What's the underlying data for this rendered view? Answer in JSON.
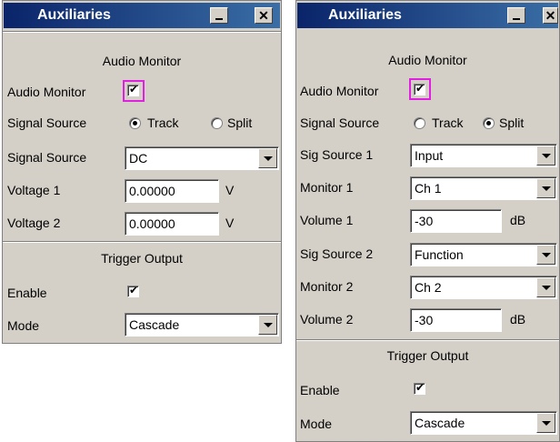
{
  "left_panel": {
    "title": "Auxiliaries",
    "min_glyph": "_",
    "close_glyph": "✕",
    "audio_monitor_header": "Audio Monitor",
    "audio_monitor_label": "Audio Monitor",
    "audio_monitor_checked": true,
    "signal_source_label": "Signal Source",
    "radio_track": "Track",
    "radio_split": "Split",
    "radio_selected": "Track",
    "signal_source2_label": "Signal Source",
    "signal_source_value": "DC",
    "voltage1_label": "Voltage 1",
    "voltage1_value": "0.00000",
    "voltage1_unit": "V",
    "voltage2_label": "Voltage 2",
    "voltage2_value": "0.00000",
    "voltage2_unit": "V",
    "trigger_header": "Trigger Output",
    "enable_label": "Enable",
    "enable_checked": true,
    "mode_label": "Mode",
    "mode_value": "Cascade"
  },
  "right_panel": {
    "title": "Auxiliaries",
    "min_glyph": "_",
    "close_glyph": "✕",
    "audio_monitor_header": "Audio Monitor",
    "audio_monitor_label": "Audio Monitor",
    "audio_monitor_checked": true,
    "signal_source_label": "Signal Source",
    "radio_track": "Track",
    "radio_split": "Split",
    "radio_selected": "Split",
    "sig_source1_label": "Sig Source 1",
    "sig_source1_value": "Input",
    "monitor1_label": "Monitor 1",
    "monitor1_value": "Ch 1",
    "volume1_label": "Volume 1",
    "volume1_value": "-30",
    "volume1_unit": "dB",
    "sig_source2_label": "Sig Source 2",
    "sig_source2_value": "Function",
    "monitor2_label": "Monitor 2",
    "monitor2_value": "Ch 2",
    "volume2_label": "Volume 2",
    "volume2_value": "-30",
    "volume2_unit": "dB",
    "trigger_header": "Trigger Output",
    "enable_label": "Enable",
    "enable_checked": true,
    "mode_label": "Mode",
    "mode_value": "Cascade"
  }
}
